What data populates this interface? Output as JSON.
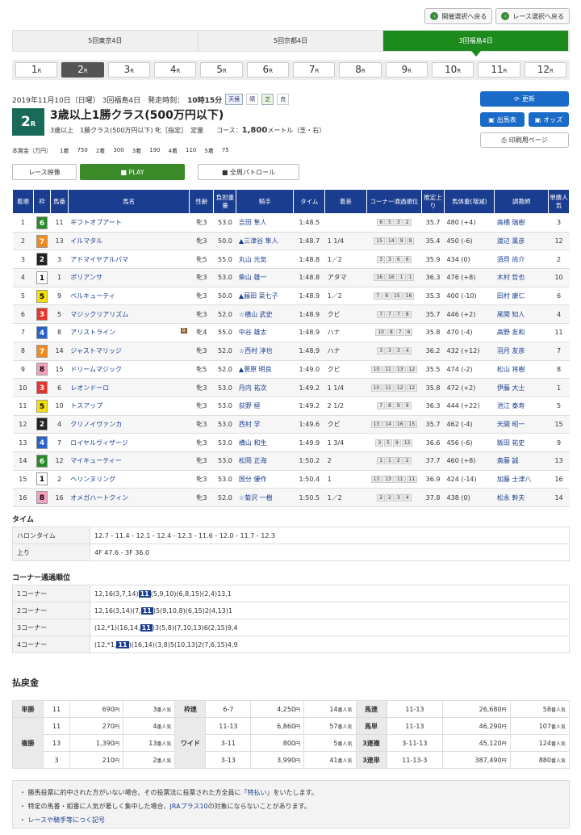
{
  "nav": {
    "back_kaisai": "開催選択へ戻る",
    "back_race": "レース選択へ戻る"
  },
  "venues": [
    "5回東京4日",
    "5回京都4日",
    "3回福島4日"
  ],
  "races": [
    "1",
    "2",
    "3",
    "4",
    "5",
    "6",
    "7",
    "8",
    "9",
    "10",
    "11",
    "12"
  ],
  "race_suffix": "R",
  "race": {
    "date": "2019年11月10日（日曜） 3回福島4日　発走時刻：",
    "post_time": "10時15分",
    "weather_label": "天候",
    "weather": "晴",
    "track_label": "芝",
    "track": "良",
    "number": "2",
    "title": "3歳以上1勝クラス(500万円以下)",
    "subtitle": "3歳以上　1勝クラス(500万円以下)  牝［指定］　定量　　コース：",
    "distance": "1,800",
    "distance_unit": "メートル（芝・右）"
  },
  "prize": [
    "本賞金（万円）",
    "1着",
    "750",
    "2着",
    "300",
    "3着",
    "190",
    "4着",
    "110",
    "5着",
    "75"
  ],
  "buttons": {
    "refresh": "更新",
    "entries": "出馬表",
    "odds": "オッズ",
    "print": "印刷用ページ"
  },
  "video": {
    "race_video": "レース映像",
    "play": "PLAY",
    "patrol": "全周パトロール"
  },
  "headers": [
    "着順",
    "枠",
    "馬番",
    "馬名",
    "性齢",
    "負担重量",
    "騎手",
    "タイム",
    "着差",
    "コーナー通過順位",
    "推定上り",
    "馬体重(増減)",
    "調教師",
    "単勝人気"
  ],
  "rows": [
    [
      "1",
      "6",
      "11",
      "ギフトオブアート",
      "牝3",
      "53.0",
      "吉田 隼人",
      "1:48.5",
      "",
      [
        "6",
        "5",
        "3",
        "2"
      ],
      "35.7",
      "480 (+4)",
      "高橋 瑞樹",
      "3"
    ],
    [
      "2",
      "7",
      "13",
      "イルマタル",
      "牝3",
      "50.0",
      "▲三津谷 隼人",
      "1:48.7",
      "1 1/4",
      [
        "15",
        "14",
        "9",
        "9"
      ],
      "35.4",
      "450 (-6)",
      "渡辺 薫彦",
      "12"
    ],
    [
      "3",
      "2",
      "3",
      "アドマイヤアルパマ",
      "牝5",
      "55.0",
      "丸山 元気",
      "1:48.8",
      "1／2",
      [
        "3",
        "3",
        "6",
        "6"
      ],
      "35.9",
      "434 (0)",
      "須貝 尚介",
      "2"
    ],
    [
      "4",
      "1",
      "1",
      "ポリアンサ",
      "牝3",
      "53.0",
      "柴山 雄一",
      "1:48.8",
      "アタマ",
      [
        "16",
        "16",
        "1",
        "1"
      ],
      "36.3",
      "476 (+8)",
      "木村 哲也",
      "10"
    ],
    [
      "5",
      "5",
      "9",
      "ベルキューティ",
      "牝3",
      "50.0",
      "▲藤田 菜七子",
      "1:48.9",
      "1／2",
      [
        "7",
        "8",
        "15",
        "16"
      ],
      "35.3",
      "400 (-10)",
      "田村 康仁",
      "6"
    ],
    [
      "6",
      "3",
      "5",
      "マジックリアリズム",
      "牝3",
      "52.0",
      "☆横山 武史",
      "1:48.9",
      "クビ",
      [
        "7",
        "7",
        "7",
        "8"
      ],
      "35.7",
      "446 (+2)",
      "尾関 知人",
      "4"
    ],
    [
      "7",
      "4",
      "8",
      "アリストライン",
      "牝4",
      "55.0",
      "中谷 雄太",
      "1:48.9",
      "ハナ",
      [
        "10",
        "8",
        "7",
        "6"
      ],
      "35.8",
      "470 (-4)",
      "高野 友和",
      "11"
    ],
    [
      "8",
      "7",
      "14",
      "ジャストマリッジ",
      "牝3",
      "52.0",
      "☆西村 淳也",
      "1:48.9",
      "ハナ",
      [
        "3",
        "3",
        "3",
        "4"
      ],
      "36.2",
      "432 (+12)",
      "羽月 友彦",
      "7"
    ],
    [
      "9",
      "8",
      "15",
      "ドリームマジック",
      "牝5",
      "52.0",
      "▲菅原 明良",
      "1:49.0",
      "クビ",
      [
        "10",
        "11",
        "13",
        "12"
      ],
      "35.5",
      "474 (-2)",
      "松山 将樹",
      "8"
    ],
    [
      "10",
      "3",
      "6",
      "レオンドーロ",
      "牝3",
      "53.0",
      "丹内 祐次",
      "1:49.2",
      "1 1/4",
      [
        "10",
        "11",
        "12",
        "12"
      ],
      "35.8",
      "472 (+2)",
      "伊藤 大士",
      "1"
    ],
    [
      "11",
      "5",
      "10",
      "トスアップ",
      "牝3",
      "53.0",
      "荻野 極",
      "1:49.2",
      "2 1/2",
      [
        "7",
        "8",
        "9",
        "9"
      ],
      "36.3",
      "444 (+22)",
      "池江 泰寿",
      "5"
    ],
    [
      "12",
      "2",
      "4",
      "クリノイヴァンカ",
      "牝3",
      "53.0",
      "西村 学",
      "1:49.6",
      "クビ",
      [
        "13",
        "14",
        "16",
        "15"
      ],
      "35.7",
      "462 (-4)",
      "天間 昭一",
      "15"
    ],
    [
      "13",
      "4",
      "7",
      "ロイヤルヴィザージ",
      "牝3",
      "53.0",
      "横山 和生",
      "1:49.9",
      "1 3/4",
      [
        "3",
        "5",
        "9",
        "12"
      ],
      "36.6",
      "456 (-6)",
      "飯田 祐史",
      "9"
    ],
    [
      "14",
      "6",
      "12",
      "マイキューティー",
      "牝3",
      "53.0",
      "松岡 正海",
      "1:50.2",
      "2",
      [
        "1",
        "1",
        "2",
        "2"
      ],
      "37.7",
      "460 (+8)",
      "斎藤 誠",
      "13"
    ],
    [
      "15",
      "1",
      "2",
      "ヘリンヌリング",
      "牝3",
      "53.0",
      "国分 優作",
      "1:50.4",
      "1",
      [
        "13",
        "13",
        "11",
        "11"
      ],
      "36.9",
      "424 (-14)",
      "加藤 士津八",
      "16"
    ],
    [
      "16",
      "8",
      "16",
      "オメガハートクィン",
      "牝3",
      "52.0",
      "☆菊沢 一樹",
      "1:50.5",
      "1／2",
      [
        "2",
        "2",
        "3",
        "4"
      ],
      "37.8",
      "438 (0)",
      "松永 幹夫",
      "14"
    ]
  ],
  "time": {
    "title": "タイム",
    "rows": [
      {
        "k": "ハロンタイム",
        "v": "12.7 - 11.4 - 12.1 - 12.4 - 12.3 - 11.6 - 12.0 - 11.7 - 12.3"
      },
      {
        "k": "上り",
        "v": "4F 47.6 - 3F 36.0"
      }
    ]
  },
  "corner": {
    "title": "コーナー通過順位",
    "rows": [
      {
        "k": "1コーナー",
        "pre": "12,16(3,7,14)",
        "hl": "11",
        "post": "(5,9,10)(6,8,15)(2,4)13,1"
      },
      {
        "k": "2コーナー",
        "pre": "12,16(3,14)(7,",
        "hl": "11",
        "post": ")5(9,10,8)(6,15)2(4,13)1"
      },
      {
        "k": "3コーナー",
        "pre": "(12,*1)(16,14,",
        "hl": "11",
        "post": ")3(5,8)(7,10,13)6(2,15)9,4"
      },
      {
        "k": "4コーナー",
        "pre": "(12,*1,",
        "hl": "11",
        "post": ")(16,14)(3,8)5(10,13)2(7,6,15)4,9"
      }
    ]
  },
  "payout": {
    "title": "払戻金",
    "tansho": "単勝",
    "fukusho": "複勝",
    "wakuren": "枠連",
    "wide": "ワイド",
    "umaren": "馬連",
    "umatan": "馬単",
    "sanrenpuku": "3連複",
    "sanrentan": "3連単",
    "yen": "円",
    "ninki": "番人気",
    "tan": {
      "num": "11",
      "amt": "690",
      "pop": "3"
    },
    "fuku": [
      {
        "num": "11",
        "amt": "270",
        "pop": "4"
      },
      {
        "num": "13",
        "amt": "1,390",
        "pop": "13"
      },
      {
        "num": "3",
        "amt": "210",
        "pop": "2"
      }
    ],
    "waku": {
      "num": "6-7",
      "amt": "4,250",
      "pop": "14"
    },
    "wide_rows": [
      {
        "num": "11-13",
        "amt": "6,860",
        "pop": "57"
      },
      {
        "num": "3-11",
        "amt": "800",
        "pop": "5"
      },
      {
        "num": "3-13",
        "amt": "3,990",
        "pop": "41"
      }
    ],
    "uren": {
      "num": "11-13",
      "amt": "26,680",
      "pop": "58"
    },
    "utan": {
      "num": "11-13",
      "amt": "46,290",
      "pop": "107"
    },
    "puku": {
      "num": "3-11-13",
      "amt": "45,120",
      "pop": "124"
    },
    "tan3": {
      "num": "11-13-3",
      "amt": "387,490",
      "pop": "880"
    }
  },
  "notes": {
    "n1a": "勝馬投票に的中された方がいない場合、その投票法に投票された方全員に「",
    "n1link": "特払い",
    "n1b": "」をいたします。",
    "n2a": "特定の馬番・組番に人気が著しく集中した場合、",
    "n2link": "JRAプラス10",
    "n2b": "の対象にならないことがあります。",
    "n3": "レースや騎手等につく記号"
  },
  "colors": {
    "waku1": "#ffffff",
    "waku2": "#222222",
    "waku3": "#e8332b",
    "waku4": "#2a63c8",
    "waku5": "#f5e100",
    "waku6": "#2a8a2a",
    "waku7": "#f28a1e",
    "waku8": "#f4a0c0"
  }
}
